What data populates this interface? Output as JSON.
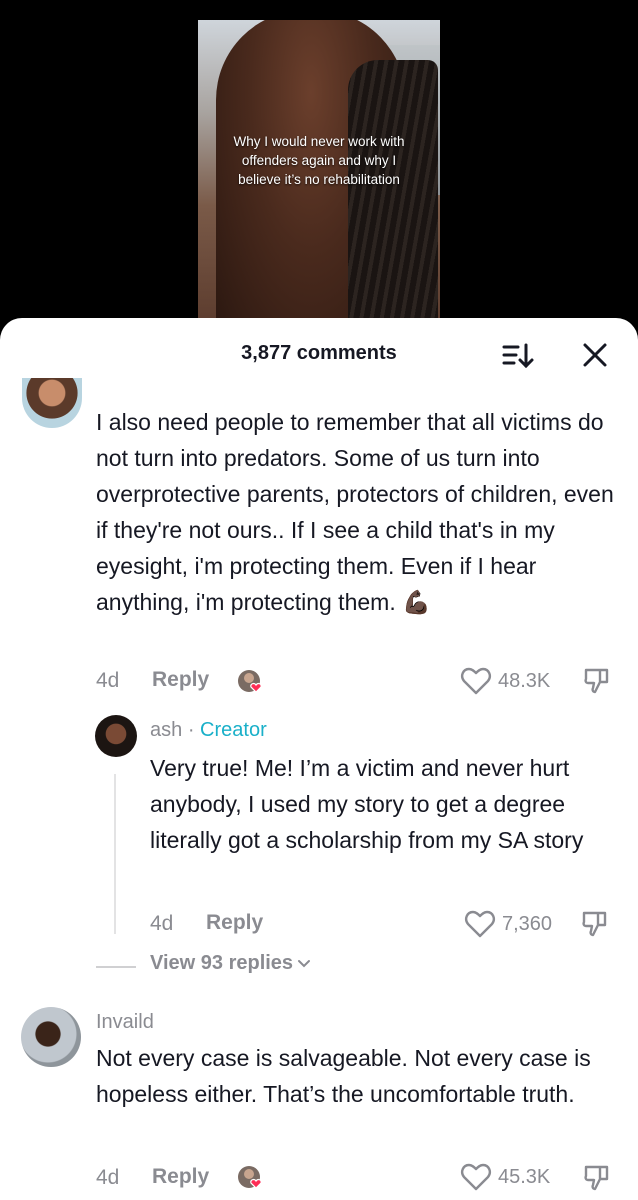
{
  "video": {
    "caption": "Why I would never work with offenders again and why I believe it’s no rehabilitation"
  },
  "comments_panel": {
    "count_label": "3,877 comments",
    "sort_icon": "sort-icon",
    "close_icon": "close-icon"
  },
  "comments": [
    {
      "username": "",
      "text": "I also need people to remember that all victims do not turn into predators. Some of us turn into overprotective parents, protectors of children, even if they're not ours.. If I see a child that's in my eyesight, i'm protecting them. Even if I hear anything, i'm protecting them. 💪🏿",
      "age": "4d",
      "reply_label": "Reply",
      "likes": "48.3K",
      "reply": {
        "username": "ash",
        "separator": "·",
        "badge": "Creator",
        "text": "Very true! Me! I’m a victim and never hurt anybody, I used my story to get a degree literally got a scholarship from my SA story",
        "age": "4d",
        "reply_label": "Reply",
        "likes": "7,360"
      },
      "view_replies_label": "View 93 replies"
    },
    {
      "username": "Invaild",
      "text": "Not every case is salvageable. Not every case is hopeless either. That’s the uncomfortable truth.",
      "age": "4d",
      "reply_label": "Reply",
      "likes": "45.3K"
    }
  ]
}
